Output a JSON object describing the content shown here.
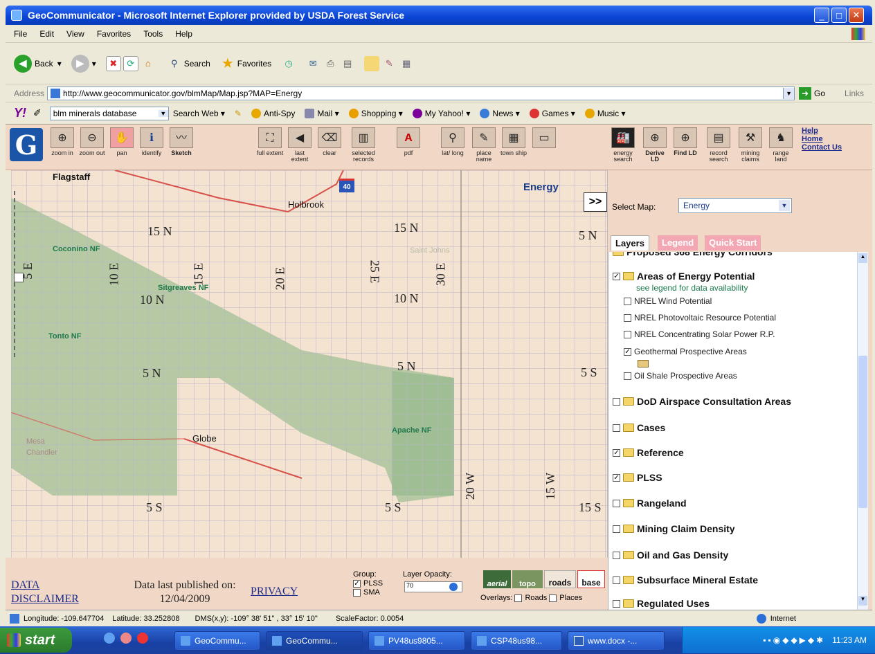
{
  "window": {
    "title": "GeoCommunicator - Microsoft Internet Explorer provided by USDA Forest Service"
  },
  "menu": [
    "File",
    "Edit",
    "View",
    "Favorites",
    "Tools",
    "Help"
  ],
  "ie_toolbar": {
    "back": "Back",
    "search": "Search",
    "favorites": "Favorites"
  },
  "address": {
    "label": "Address",
    "url": "http://www.geocommunicator.gov/blmMap/Map.jsp?MAP=Energy",
    "go": "Go",
    "links": "Links"
  },
  "yahoo_bar": {
    "search_value": "blm minerals database",
    "search_web": "Search Web",
    "items": [
      "Anti-Spy",
      "Mail",
      "Shopping",
      "My Yahoo!",
      "News",
      "Games",
      "Music"
    ]
  },
  "app_tools": [
    {
      "name": "zoom-in",
      "label": "zoom in",
      "icon": "zoom-in-icon"
    },
    {
      "name": "zoom-out",
      "label": "zoom out",
      "icon": "zoom-out-icon"
    },
    {
      "name": "pan",
      "label": "pan",
      "icon": "hand-icon"
    },
    {
      "name": "identify",
      "label": "identify",
      "icon": "info-icon"
    },
    {
      "name": "sketch",
      "label": "Sketch",
      "icon": "sketch-icon"
    },
    {
      "name": "full-extent",
      "label": "full extent",
      "icon": "full-extent-icon"
    },
    {
      "name": "last-extent",
      "label": "last extent",
      "icon": "back-arrow-icon"
    },
    {
      "name": "clear",
      "label": "clear",
      "icon": "eraser-icon"
    },
    {
      "name": "selected-records",
      "label": "selected records",
      "icon": "records-icon"
    },
    {
      "name": "pdf",
      "label": "pdf",
      "icon": "pdf-icon"
    },
    {
      "name": "lat-long",
      "label": "lat/ long",
      "icon": "latlong-icon"
    },
    {
      "name": "place-name",
      "label": "place name",
      "icon": "pencil-icon"
    },
    {
      "name": "township",
      "label": "town ship",
      "icon": "grid-icon"
    },
    {
      "name": "blank-tool",
      "label": "",
      "icon": "window-icon"
    },
    {
      "name": "energy-search",
      "label": "energy search",
      "icon": "factory-icon"
    },
    {
      "name": "derive-ld",
      "label": "Derive LD",
      "icon": "globe-icon"
    },
    {
      "name": "find-ld",
      "label": "Find LD",
      "icon": "globe-icon"
    },
    {
      "name": "record-search",
      "label": "record search",
      "icon": "document-icon"
    },
    {
      "name": "mining-claims",
      "label": "mining claims",
      "icon": "pickaxe-icon"
    },
    {
      "name": "range-land",
      "label": "range land",
      "icon": "cow-icon"
    }
  ],
  "help_links": [
    "Help",
    "Home",
    "Contact Us"
  ],
  "map": {
    "title": "Energy",
    "township_labels": [
      "15 N",
      "15 N",
      "5 N",
      "10 N",
      "10 N",
      "5 N",
      "5 N",
      "5 S",
      "5 S",
      "5 S",
      "15 S"
    ],
    "range_labels": [
      "5 E",
      "10 E",
      "15 E",
      "20 E",
      "25 E",
      "30 E",
      "20 W",
      "15 W"
    ],
    "places": [
      "Flagstaff",
      "Holbrook",
      "Globe",
      "Mesa",
      "Chandler",
      "Saint Johns"
    ],
    "forests": [
      "Coconino NF",
      "Sitgreaves NF",
      "Tonto NF",
      "Apache NF"
    ],
    "highway": "40"
  },
  "panel": {
    "select_map_label": "Select Map:",
    "select_map_value": "Energy",
    "collapse": ">>",
    "tabs": [
      "Layers",
      "Legend",
      "Quick Start"
    ],
    "partial_top": "Proposed 368 Energy Corridors",
    "energy_group": "Areas of Energy Potential",
    "energy_note": "see legend for data availability",
    "energy_layers": [
      {
        "label": "NREL Wind Potential",
        "checked": false
      },
      {
        "label": "NREL Photovoltaic Resource Potential",
        "checked": false
      },
      {
        "label": "NREL Concentrating Solar Power R.P.",
        "checked": false
      },
      {
        "label": "Geothermal Prospective Areas",
        "checked": true
      },
      {
        "label": "Oil Shale Prospective Areas",
        "checked": false
      }
    ],
    "groups": [
      {
        "label": "DoD Airspace Consultation Areas",
        "checked": false
      },
      {
        "label": "Cases",
        "checked": false
      },
      {
        "label": "Reference",
        "checked": true
      },
      {
        "label": "PLSS",
        "checked": true
      },
      {
        "label": "Rangeland",
        "checked": false
      },
      {
        "label": "Mining Claim Density",
        "checked": false
      },
      {
        "label": "Oil and Gas Density",
        "checked": false
      },
      {
        "label": "Subsurface Mineral Estate",
        "checked": false
      },
      {
        "label": "Regulated Uses",
        "checked": false
      }
    ]
  },
  "footer": {
    "disclaimer_line1": "DATA",
    "disclaimer_line2": "DISCLAIMER",
    "published_label": "Data last published on:",
    "published_date": "12/04/2009",
    "privacy": "PRIVACY",
    "group_label": "Group:",
    "group_plss": "PLSS",
    "group_sma": "SMA",
    "layer_opacity": "Layer Opacity:",
    "opacity_value": "70",
    "basemaps": [
      "aerial",
      "topo",
      "roads",
      "base"
    ],
    "overlays_label": "Overlays:",
    "overlay_roads": "Roads",
    "overlay_places": "Places"
  },
  "status": {
    "longitude": "Longitude: -109.647704",
    "latitude": "Latitude: 33.252808",
    "dms": "DMS(x,y): -109° 38' 51\" , 33° 15' 10\"",
    "scale": "ScaleFactor: 0.0054",
    "zone": "Internet"
  },
  "taskbar": {
    "start": "start",
    "tasks": [
      "GeoCommu...",
      "GeoCommu...",
      "PV48us9805...",
      "CSP48us98...",
      "www.docx -..."
    ],
    "time": "11:23 AM"
  },
  "colors": {
    "app_bg": "#f1d7c5",
    "forest_green": "#a9c29c",
    "xp_blue": "#0a44d4",
    "start_green": "#2b7a2b"
  }
}
